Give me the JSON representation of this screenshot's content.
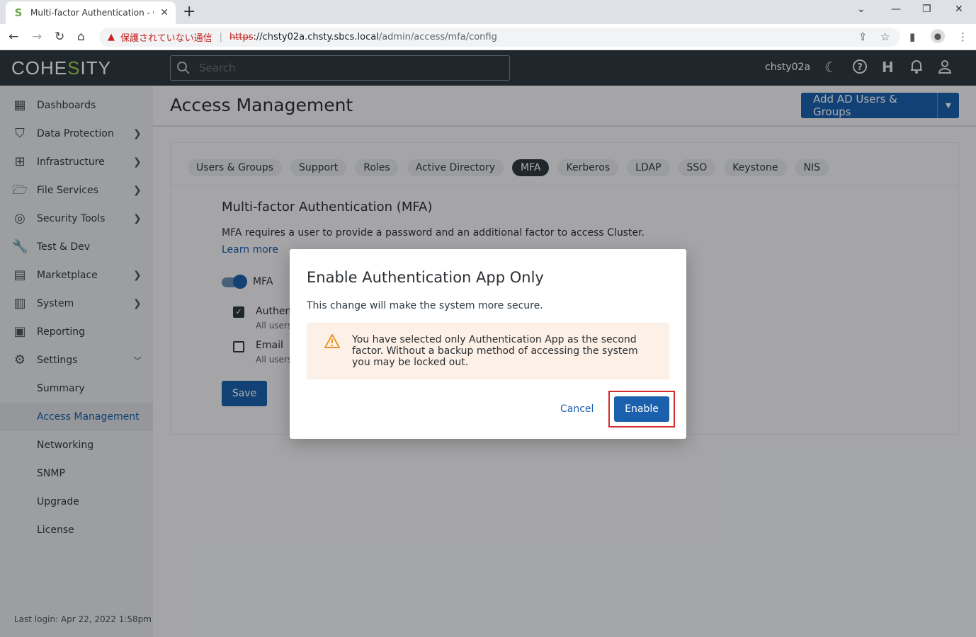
{
  "browser": {
    "tab_title": "Multi-factor Authentication - Col",
    "insecure_label": "保護されていない通信",
    "url_protocol": "https",
    "url_host": "://chsty02a.chsty.sbcs.local",
    "url_path": "/admin/access/mfa/config"
  },
  "header": {
    "logo_pre": "COHE",
    "logo_accent": "S",
    "logo_post": "ITY",
    "search_placeholder": "Search",
    "cluster_name": "chsty02a"
  },
  "sidebar": {
    "items": [
      {
        "label": "Dashboards",
        "icon": "dashboard-icon"
      },
      {
        "label": "Data Protection",
        "icon": "shield-icon"
      },
      {
        "label": "Infrastructure",
        "icon": "infrastructure-icon"
      },
      {
        "label": "File Services",
        "icon": "folder-icon"
      },
      {
        "label": "Security Tools",
        "icon": "fingerprint-icon"
      },
      {
        "label": "Test & Dev",
        "icon": "wrench-icon"
      },
      {
        "label": "Marketplace",
        "icon": "store-icon"
      },
      {
        "label": "System",
        "icon": "system-icon"
      },
      {
        "label": "Reporting",
        "icon": "chart-icon"
      },
      {
        "label": "Settings",
        "icon": "gear-icon"
      }
    ],
    "settings_sub": [
      "Summary",
      "Access Management",
      "Networking",
      "SNMP",
      "Upgrade",
      "License"
    ],
    "last_login": "Last login: Apr 22, 2022 1:58pm"
  },
  "main": {
    "page_title": "Access Management",
    "add_button": "Add AD Users & Groups",
    "tabs": [
      "Users & Groups",
      "Support",
      "Roles",
      "Active Directory",
      "MFA",
      "Kerberos",
      "LDAP",
      "SSO",
      "Keystone",
      "NIS"
    ],
    "selected_tab": "MFA",
    "mfa_heading": "Multi-factor Authentication (MFA)",
    "mfa_description": "MFA requires a user to provide a password and an additional factor to access Cluster.",
    "learn_more": "Learn more",
    "toggle_label": "MFA",
    "option_auth_label": "Authen",
    "option_auth_sub": "All users",
    "option_email_label": "Email",
    "option_email_sub": "All users",
    "save_label": "Save"
  },
  "modal": {
    "title": "Enable Authentication App Only",
    "subtitle": "This change will make the system more secure.",
    "warning": "You have selected only Authentication App as the second factor. Without a backup method of accessing the system you may be locked out.",
    "cancel_label": "Cancel",
    "enable_label": "Enable"
  },
  "colors": {
    "primary": "#1a60ad",
    "header_bg": "#2f3a42",
    "logo_accent": "#9bd24a",
    "warning_bg": "#fdf0e6",
    "warning_icon": "#e8962b",
    "highlight_border": "#d32b2b"
  }
}
